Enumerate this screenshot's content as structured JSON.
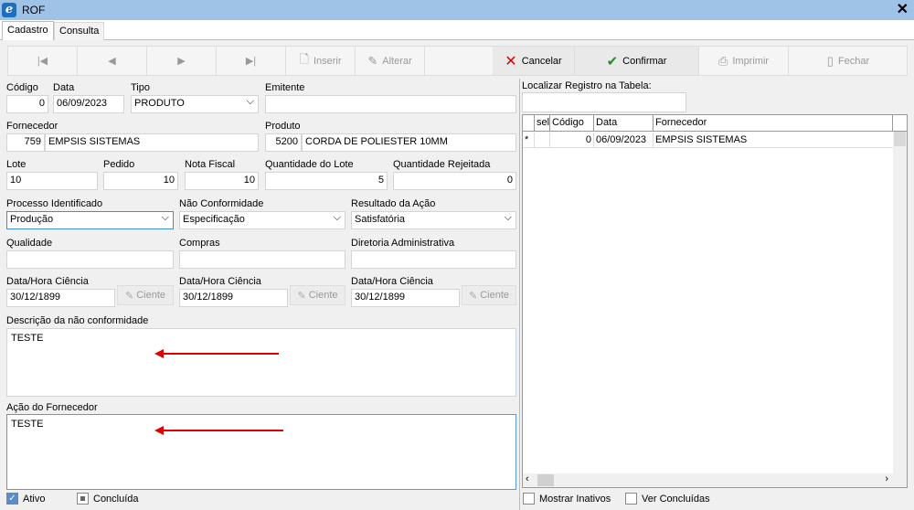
{
  "window": {
    "title": "ROF",
    "close": "✕",
    "icon": "e"
  },
  "tabs": [
    "Cadastro",
    "Consulta"
  ],
  "toolbar": {
    "first": "|◀",
    "prev": "◀",
    "next": "▶",
    "last": "▶|",
    "insert": "Inserir",
    "edit": "Alterar",
    "cancel": "Cancelar",
    "confirm": "Confirmar",
    "print": "Imprimir",
    "close": "Fechar"
  },
  "form": {
    "codigo_label": "Código",
    "codigo": "0",
    "data_label": "Data",
    "data": "06/09/2023",
    "tipo_label": "Tipo",
    "tipo": "PRODUTO",
    "emitente_label": "Emitente",
    "emitente": "",
    "fornecedor_label": "Fornecedor",
    "fornecedor_code": "759",
    "fornecedor_name": "EMPSIS SISTEMAS",
    "produto_label": "Produto",
    "produto_code": "5200",
    "produto_name": "CORDA DE POLIESTER 10MM",
    "lote_label": "Lote",
    "lote": "10",
    "pedido_label": "Pedido",
    "pedido": "10",
    "nota_label": "Nota Fiscal",
    "nota": "10",
    "qtd_lote_label": "Quantidade do Lote",
    "qtd_lote": "5",
    "qtd_rej_label": "Quantidade Rejeitada",
    "qtd_rej": "0",
    "processo_label": "Processo Identificado",
    "processo": "Produção",
    "nao_conf_label": "Não Conformidade",
    "nao_conf": "Especificação",
    "resultado_label": "Resultado da Ação",
    "resultado": "Satisfatória",
    "qualidade_label": "Qualidade",
    "compras_label": "Compras",
    "diretoria_label": "Diretoria Administrativa",
    "ciencia_label": "Data/Hora Ciência",
    "ciencia_value": "30/12/1899",
    "ciente_btn": "Ciente",
    "descricao_label": "Descrição da não conformidade",
    "descricao": "TESTE",
    "acao_label": "Ação do Fornecedor",
    "acao": "TESTE",
    "ativo_label": "Ativo",
    "concluida_label": "Concluída"
  },
  "right": {
    "search_label": "Localizar Registro na Tabela:",
    "columns": [
      "sel",
      "Código",
      "Data",
      "Fornecedor"
    ],
    "row": {
      "marker": "*",
      "codigo": "0",
      "data": "06/09/2023",
      "fornecedor": "EMPSIS SISTEMAS"
    },
    "show_inactive": "Mostrar Inativos",
    "show_done": "Ver Concluídas"
  },
  "colors": {
    "titlebar": "#9fc3e6",
    "arrow": "#e00000",
    "accent": "#3a8fd6"
  }
}
